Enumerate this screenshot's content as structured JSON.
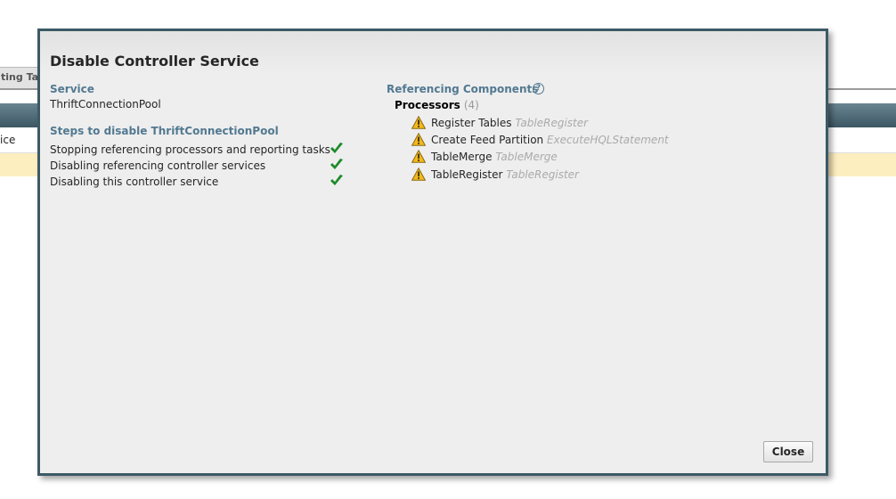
{
  "background": {
    "tab_label": "ting Tas",
    "row_text": "rvice"
  },
  "dialog": {
    "title": "Disable Controller Service",
    "service_heading": "Service",
    "service_name": "ThriftConnectionPool",
    "steps_heading": "Steps to disable ThriftConnectionPool",
    "steps": [
      {
        "label": "Stopping referencing processors and reporting tasks",
        "status": "done"
      },
      {
        "label": "Disabling referencing controller services",
        "status": "done"
      },
      {
        "label": "Disabling this controller service",
        "status": "done"
      }
    ],
    "referencing_heading": "Referencing Components",
    "help_icon": "?",
    "processors_label": "Processors",
    "processors_count": "(4)",
    "processors": [
      {
        "name": "Register Tables",
        "type": "TableRegister",
        "icon": "warning-icon"
      },
      {
        "name": "Create Feed Partition",
        "type": "ExecuteHQLStatement",
        "icon": "warning-icon"
      },
      {
        "name": "TableMerge",
        "type": "TableMerge",
        "icon": "warning-icon"
      },
      {
        "name": "TableRegister",
        "type": "TableRegister",
        "icon": "warning-icon"
      }
    ],
    "close_label": "Close"
  },
  "colors": {
    "dialog_border": "#3b5a66",
    "section_heading": "#527991",
    "check_green": "#1e8a2a",
    "warning_yellow": "#f2b91e"
  }
}
